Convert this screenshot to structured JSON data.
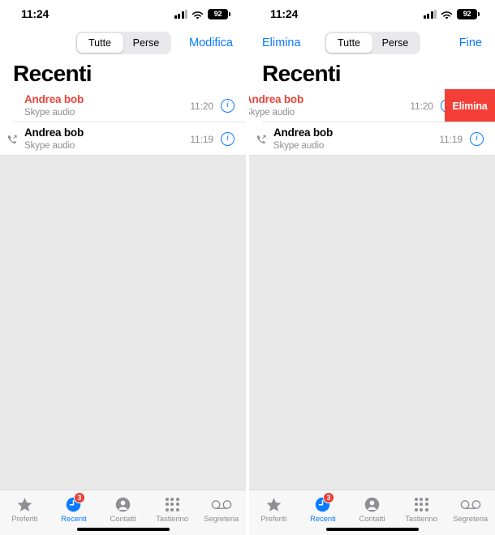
{
  "statusbar": {
    "time": "11:24",
    "battery_level": "92",
    "signal_icon": "cellular-signal-icon",
    "wifi_icon": "wifi-icon",
    "battery_icon": "battery-icon"
  },
  "panels": [
    {
      "id": "left",
      "nav": {
        "left_label": "",
        "right_label": "Modifica",
        "has_left_button": false
      },
      "segmented": {
        "options": [
          "Tutte",
          "Perse"
        ],
        "selected": "Tutte"
      },
      "title": "Recenti",
      "rows": [
        {
          "name": "Andrea bob",
          "subtitle": "Skype audio",
          "time": "11:20",
          "missed": true,
          "has_direction_icon": false,
          "swiped": false,
          "delete_label": ""
        },
        {
          "name": "Andrea bob",
          "subtitle": "Skype audio",
          "time": "11:19",
          "missed": false,
          "has_direction_icon": true,
          "swiped": false,
          "delete_label": ""
        }
      ]
    },
    {
      "id": "right",
      "nav": {
        "left_label": "Elimina",
        "right_label": "Fine",
        "has_left_button": true
      },
      "segmented": {
        "options": [
          "Tutte",
          "Perse"
        ],
        "selected": "Tutte"
      },
      "title": "Recenti",
      "rows": [
        {
          "name": "Andrea bob",
          "subtitle": "Skype audio",
          "time": "11:20",
          "missed": true,
          "has_direction_icon": false,
          "swiped": true,
          "delete_label": "Elimina"
        },
        {
          "name": "Andrea bob",
          "subtitle": "Skype audio",
          "time": "11:19",
          "missed": false,
          "has_direction_icon": true,
          "swiped": false,
          "delete_label": ""
        }
      ]
    }
  ],
  "tabbar": {
    "items": [
      {
        "label": "Preferiti",
        "icon": "star-icon",
        "active": false,
        "badge": ""
      },
      {
        "label": "Recenti",
        "icon": "clock-icon",
        "active": true,
        "badge": "3"
      },
      {
        "label": "Contatti",
        "icon": "person-icon",
        "active": false,
        "badge": ""
      },
      {
        "label": "Tastierino",
        "icon": "keypad-icon",
        "active": false,
        "badge": ""
      },
      {
        "label": "Segreteria",
        "icon": "voicemail-icon",
        "active": false,
        "badge": ""
      }
    ]
  },
  "info_button_glyph": "i",
  "colors": {
    "accent": "#0a7aff",
    "missed": "#e8453c",
    "delete": "#f43f37",
    "badge": "#ef3b30",
    "empty_bg": "#e9e9e9",
    "tabbar_bg": "#f7f7f7"
  }
}
